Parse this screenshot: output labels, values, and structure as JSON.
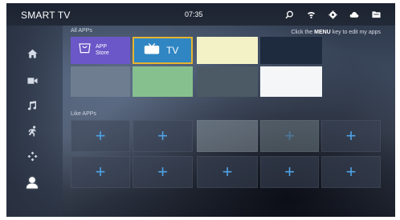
{
  "header": {
    "app_title": "SMART TV",
    "clock": "07:35",
    "icons": [
      "search-icon",
      "wifi-icon",
      "settings-icon",
      "cloud-icon",
      "folder-icon"
    ]
  },
  "sidebar": {
    "items": [
      {
        "name": "home-icon"
      },
      {
        "name": "video-icon"
      },
      {
        "name": "music-icon"
      },
      {
        "name": "sports-icon"
      },
      {
        "name": "games-icon"
      },
      {
        "name": "user-icon",
        "active": true
      }
    ]
  },
  "all_apps": {
    "label": "All APPs",
    "hint_prefix": "Click the",
    "hint_key": "MENU",
    "hint_suffix": "key to edit my apps",
    "tiles": [
      {
        "label_line1": "APP",
        "label_line2": "Store",
        "color": "#6b57c8"
      },
      {
        "label": "TV",
        "color": "#2f86c3",
        "selected": true
      },
      {
        "color": "#f3f2c7"
      },
      {
        "color": "#1e2a3e"
      },
      {
        "color": "#6f7d90"
      },
      {
        "color": "#86c08f"
      },
      {
        "color": "#4b5a64"
      },
      {
        "color": "#f4f6f8"
      }
    ]
  },
  "like_apps": {
    "label": "Like APPs",
    "slots_count": 10
  },
  "colors": {
    "accent_plus": "#4ea3e6",
    "selection_border": "#e7b52f"
  }
}
